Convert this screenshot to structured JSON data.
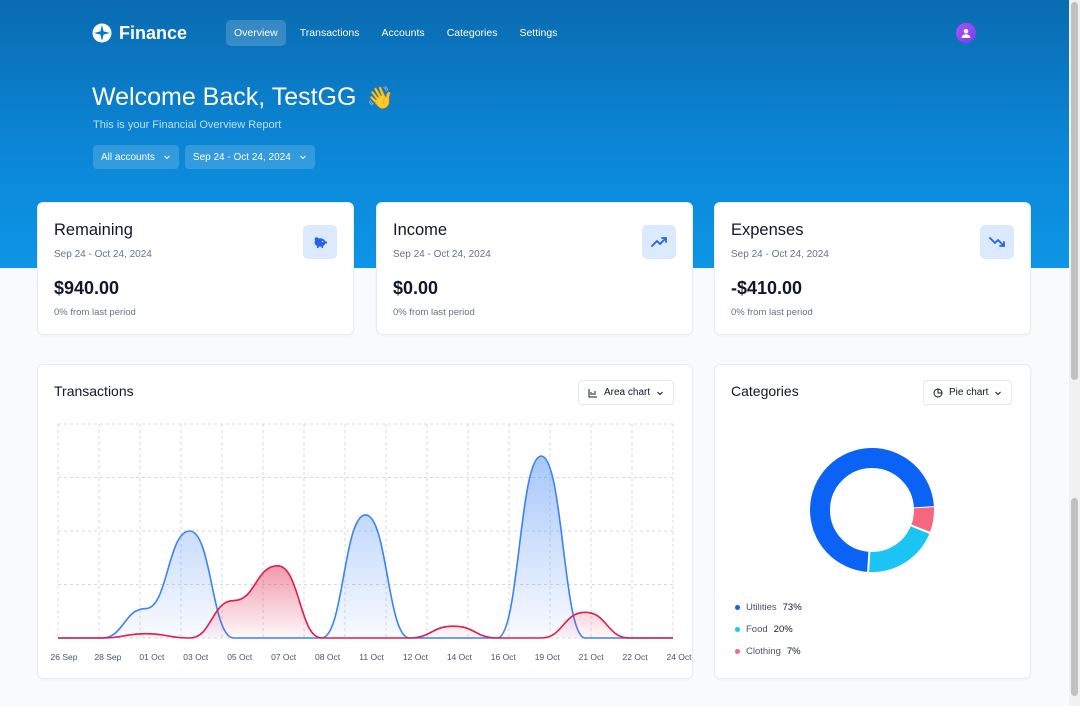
{
  "app": {
    "name": "Finance"
  },
  "nav": {
    "items": [
      "Overview",
      "Transactions",
      "Accounts",
      "Categories",
      "Settings"
    ],
    "active": "Overview"
  },
  "welcome": {
    "title": "Welcome Back, TestGG",
    "emoji": "👋",
    "subtitle": "This is your Financial Overview Report"
  },
  "filters": {
    "account": "All accounts",
    "date_range": "Sep 24 - Oct 24, 2024"
  },
  "stats": [
    {
      "title": "Remaining",
      "range": "Sep 24 - Oct 24, 2024",
      "value": "$940.00",
      "change": "0% from last period",
      "icon": "piggy-bank-icon"
    },
    {
      "title": "Income",
      "range": "Sep 24 - Oct 24, 2024",
      "value": "$0.00",
      "change": "0% from last period",
      "icon": "trending-up-icon"
    },
    {
      "title": "Expenses",
      "range": "Sep 24 - Oct 24, 2024",
      "value": "-$410.00",
      "change": "0% from last period",
      "icon": "trending-down-icon"
    }
  ],
  "transactions": {
    "title": "Transactions",
    "chart_select": "Area chart"
  },
  "categories_panel": {
    "title": "Categories",
    "chart_select": "Pie chart",
    "legend": [
      {
        "name": "Utilities",
        "pct": "73%",
        "color": "#0b63f6"
      },
      {
        "name": "Food",
        "pct": "20%",
        "color": "#1cc4f3"
      },
      {
        "name": "Clothing",
        "pct": "7%",
        "color": "#f4677e"
      }
    ]
  },
  "colors": {
    "income": "#3b82f6",
    "expenses": "#e11d48",
    "accent": "#0b86d6"
  },
  "chart_data": [
    {
      "type": "area",
      "title": "Transactions",
      "x": [
        "26 Sep",
        "28 Sep",
        "01 Oct",
        "03 Oct",
        "05 Oct",
        "07 Oct",
        "08 Oct",
        "11 Oct",
        "12 Oct",
        "14 Oct",
        "16 Oct",
        "19 Oct",
        "21 Oct",
        "22 Oct",
        "24 Oct"
      ],
      "xlabel": "",
      "ylabel": "",
      "grid": true,
      "series": [
        {
          "values": [
            0,
            0,
            55,
            200,
            0,
            0,
            0,
            230,
            0,
            0,
            0,
            340,
            0,
            0,
            0
          ]
        },
        {
          "values": [
            0,
            0,
            8,
            0,
            70,
            135,
            0,
            0,
            0,
            22,
            0,
            0,
            48,
            0,
            0
          ]
        }
      ],
      "ylim": [
        0,
        400
      ]
    },
    {
      "type": "pie",
      "title": "Categories",
      "categories": [
        "Utilities",
        "Food",
        "Clothing"
      ],
      "values": [
        73,
        20,
        7
      ]
    }
  ]
}
